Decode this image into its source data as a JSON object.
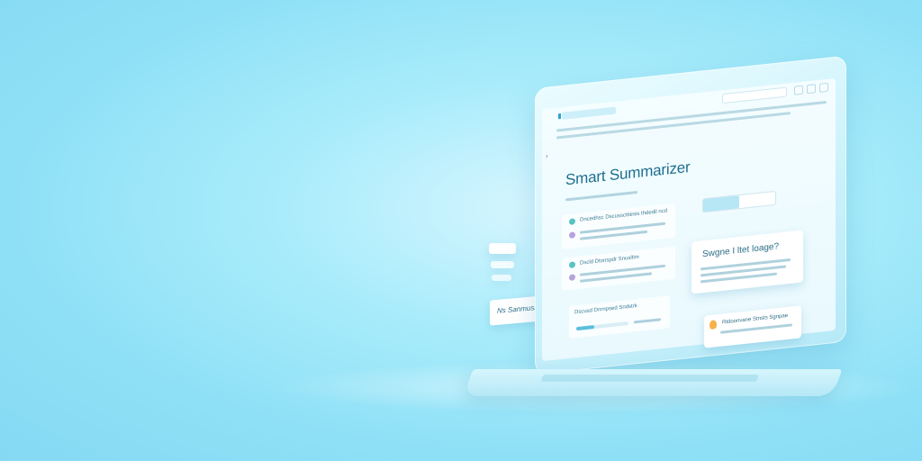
{
  "app": {
    "title": "Smart Summarizer"
  },
  "summary_panel": {
    "heading": "Swgne I ltet loage?"
  },
  "tabs": [
    {
      "label": ""
    },
    {
      "label": ""
    }
  ],
  "floating_card": {
    "label": "Ns Sanmuslyg"
  },
  "cards": [
    {
      "title": "Dncedhsc Dscusscttiesis thdedil ncd"
    },
    {
      "title": "Dscld Dtonspdr Snusltim"
    },
    {
      "title": "Dscusd Dnrnpsed Sndstrk"
    }
  ],
  "tip_card": {
    "title": "Rtdoonvane Stnsts Sgnpae"
  },
  "progress": {
    "value": 0.35
  },
  "colors": {
    "accent": "#1e6f8f",
    "background": "#a9ecfb",
    "tip_icon": "#f6b24a"
  },
  "icons": {
    "back": "chevron-left-icon",
    "tip": "lightbulb-icon"
  }
}
